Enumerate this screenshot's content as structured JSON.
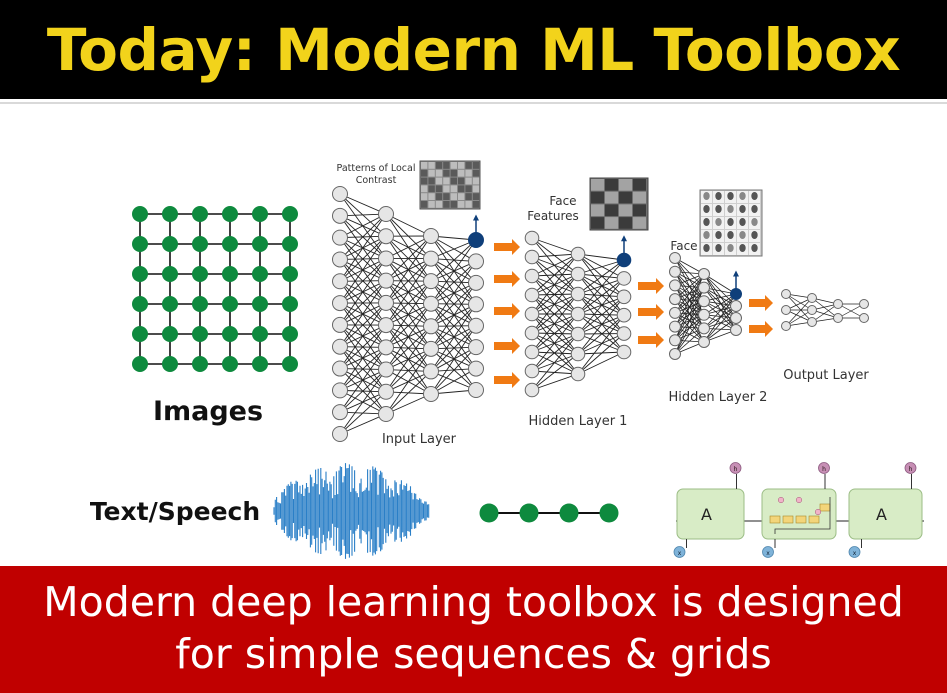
{
  "slide": {
    "title": "Today: Modern ML Toolbox",
    "caption_line1": "Modern deep learning toolbox is designed",
    "caption_line2": "for simple sequences & grids"
  },
  "labels": {
    "images": "Images",
    "text_speech": "Text/Speech",
    "patterns": "Patterns of Local",
    "patterns2": "Contrast",
    "face_features1": "Face",
    "face_features2": "Features",
    "face": "Face",
    "input_layer": "Input Layer",
    "hidden_layer_1": "Hidden Layer 1",
    "hidden_layer_2": "Hidden Layer 2",
    "output_layer": "Output Layer",
    "rnn_cell": "A",
    "rnn_h": "h",
    "rnn_x": "x"
  },
  "colors": {
    "title_text": "#f2d31b",
    "title_bg": "#000000",
    "caption_bg": "#c00000",
    "grid_node": "#0e8a3e",
    "arrow": "#f07a13",
    "highlight_node": "#0f3f7a",
    "waveform": "#2a7fc7",
    "rnn_cell": "#d8ecc6",
    "rnn_h": "#c78fb5",
    "rnn_x": "#7fb3d9"
  }
}
